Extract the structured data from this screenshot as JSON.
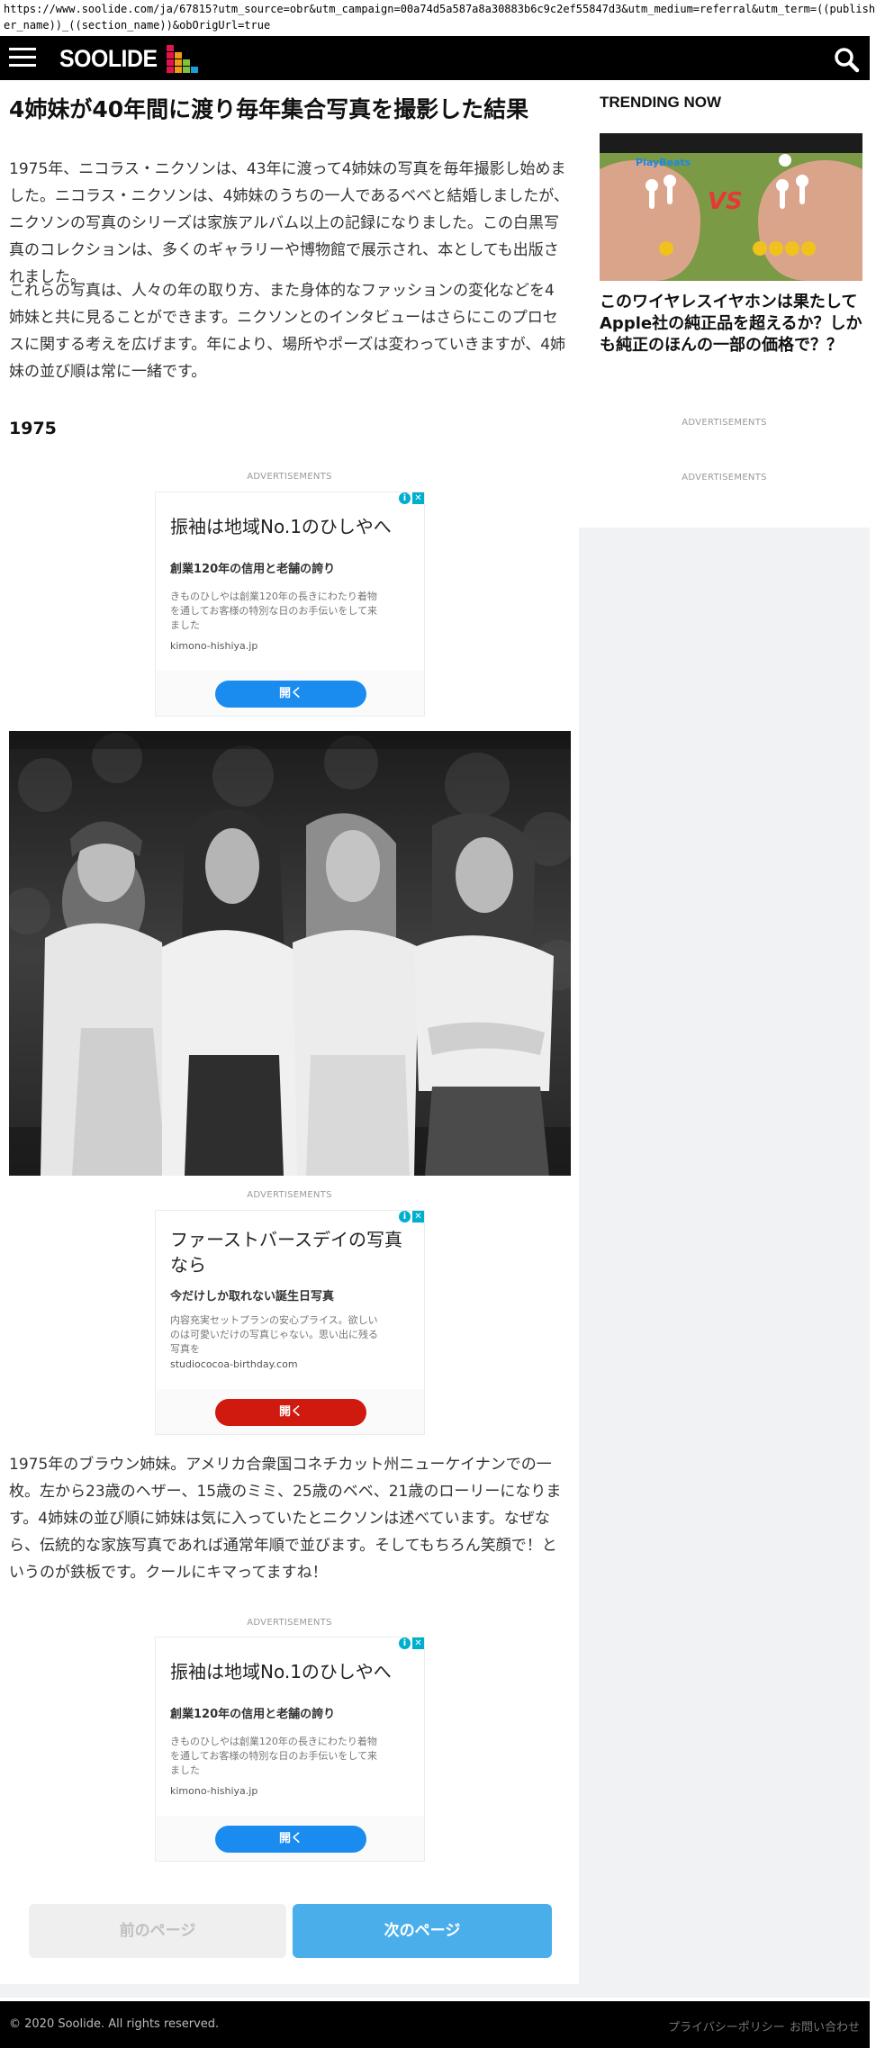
{
  "browser": {
    "url": "https://www.soolide.com/ja/67815?utm_source=obr&utm_campaign=00a74d5a587a8a30883b6c9c2ef55847d3&utm_medium=referral&utm_term=((publisher_name))_((section_name))&obOrigUrl=true"
  },
  "header": {
    "logo_text": "SOOLIDE",
    "icons": {
      "menu": "hamburger-icon",
      "search": "search-icon"
    },
    "colors": {
      "bar": "#000000"
    }
  },
  "article": {
    "title": "4姉妹が40年間に渡り毎年集合写真を撮影した結果",
    "paragraph1": "1975年、ニコラス・ニクソンは、43年に渡って4姉妹の写真を毎年撮影し始めました。ニコラス・ニクソンは、4姉妹のうちの一人であるベベと結婚しましたが、ニクソンの写真のシリーズは家族アルバム以上の記録になりました。この白黒写真のコレクションは、多くのギャラリーや博物館で展示され、本としても出版されました。",
    "paragraph2": "これらの写真は、人々の年の取り方、また身体的なファッションの変化などを4姉妹と共に見ることができます。ニクソンとのインタビューはさらにこのプロセスに関する考えを広げます。年により、場所やポーズは変わっていきますが、4姉妹の並び順は常に一緒です。",
    "year_heading": "1975",
    "caption": "1975年のブラウン姉妹。アメリカ合衆国コネチカット州ニューケイナンでの一枚。左から23歳のヘザー、15歳のミミ、25歳のベベ、21歳のローリーになります。4姉妹の並び順に姉妹は気に入っていたとニクソンは述べています。なぜなら、伝統的な家族写真であれば通常年順で並びます。そしてもちろん笑顔で！というのが鉄板です。クールにキマってますね！"
  },
  "ads": {
    "label": "ADVERTISEMENTS",
    "ad1": {
      "headline": "振袖は地域No.1のひしやへ",
      "sub": "創業120年の信用と老舗の誇り",
      "desc": "きものひしやは創業120年の長きにわたり着物を通してお客様の特別な日のお手伝いをして来ました",
      "domain": "kimono-hishiya.jp",
      "button": "開く",
      "button_color": "#1a8cf0"
    },
    "ad2": {
      "headline": "ファーストバースデイの写真なら",
      "sub": "今だけしか取れない誕生日写真",
      "desc": "内容充実セットプランの安心プライス。欲しいのは可愛いだけの写真じゃない。思い出に残る写真を",
      "domain": "studiococoa-birthday.com",
      "button": "開く",
      "button_color": "#d0190f"
    },
    "ad3": {
      "headline": "振袖は地域No.1のひしやへ",
      "sub": "創業120年の信用と老舗の誇り",
      "desc": "きものひしやは創業120年の長きにわたり着物を通してお客様の特別な日のお手伝いをして来ました",
      "domain": "kimono-hishiya.jp",
      "button": "開く",
      "button_color": "#1a8cf0"
    },
    "icons": {
      "info": "info-icon",
      "close": "close-icon"
    }
  },
  "pagination": {
    "prev": "前のページ",
    "next": "次のページ",
    "next_color": "#4aaeea"
  },
  "sidebar": {
    "trending_title": "TRENDING NOW",
    "trending_image_text": {
      "left_brand": "PlayBeats",
      "vs": "VS"
    },
    "trending_headline": "このワイヤレスイヤホンは果たして Apple社の純正品を超えるか？しかも純正のほんの一部の価格で？？",
    "ad_label_1": "ADVERTISEMENTS",
    "ad_label_2": "ADVERTISEMENTS"
  },
  "footer": {
    "copyright": "© 2020 Soolide. All rights reserved.",
    "privacy": "プライバシーポリシー",
    "contact": "お問い合わせ"
  }
}
